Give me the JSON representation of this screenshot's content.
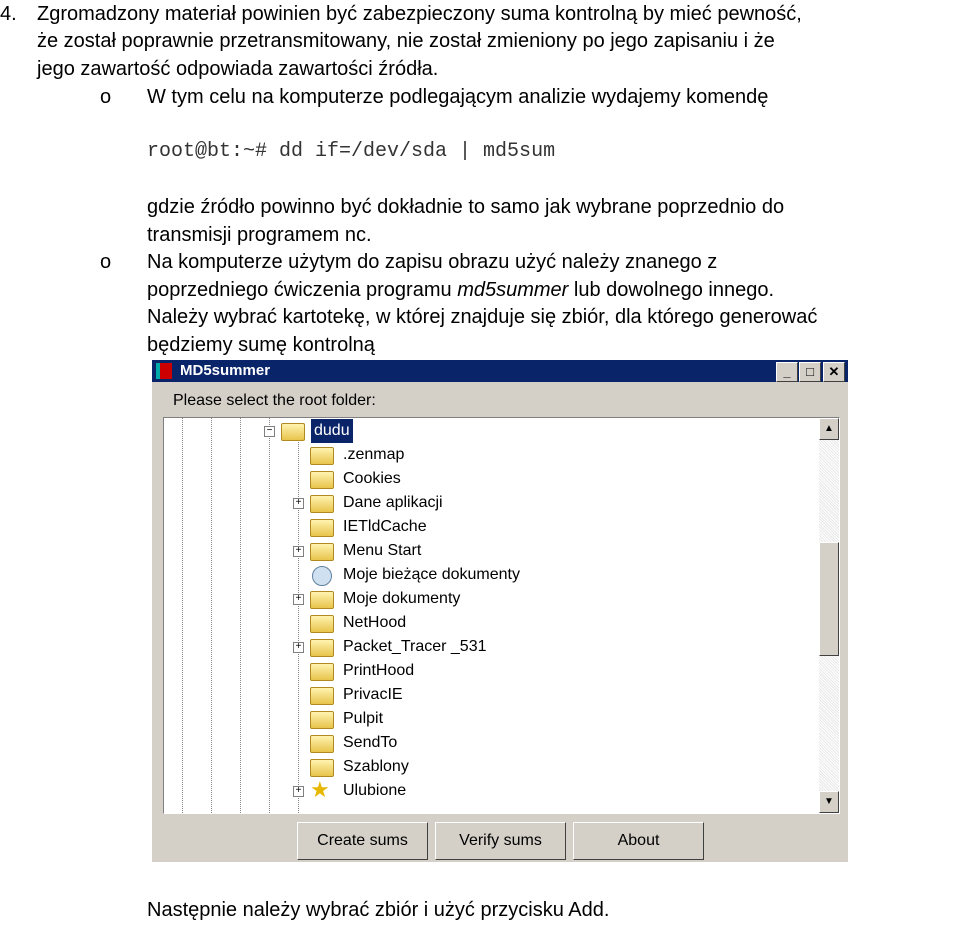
{
  "document": {
    "item_number": "4.",
    "para1_lines": [
      "Zgromadzony materiał powinien być zabezpieczony suma kontrolną by mieć pewność,",
      "że został poprawnie przetransmitowany, nie został zmieniony po jego zapisaniu i że",
      "jego zawartość odpowiada zawartości źródła."
    ],
    "bullet_glyph": "o",
    "bullet1": "W tym celu na komputerze podlegającym analizie wydajemy komendę",
    "command": "root@bt:~# dd if=/dev/sda | md5sum",
    "note_lines": [
      "gdzie źródło powinno być dokładnie to samo jak wybrane poprzednio do",
      "transmisji programem nc."
    ],
    "bullet2_line1": "Na komputerze użytym do zapisu obrazu użyć należy znanego z",
    "bullet2_line2_pre": "poprzedniego ćwiczenia programu ",
    "bullet2_line2_em": "md5summer",
    "bullet2_line2_post": " lub dowolnego innego.",
    "para2_lines": [
      "Należy wybrać kartotekę, w której znajduje się zbiór, dla którego generować",
      "będziemy sumę kontrolną"
    ],
    "final": "Następnie należy wybrać zbiór i użyć przycisku Add."
  },
  "window": {
    "title": "MD5summer",
    "prompt": "Please select the root folder:",
    "tree": [
      {
        "label": "dudu",
        "icon": "folder-open-icon",
        "expander": "minus",
        "selected": true
      },
      {
        "label": ".zenmap",
        "icon": "folder-icon"
      },
      {
        "label": "Cookies",
        "icon": "folder-icon"
      },
      {
        "label": "Dane aplikacji",
        "icon": "folder-icon",
        "expander": "plus"
      },
      {
        "label": "IETldCache",
        "icon": "folder-icon"
      },
      {
        "label": "Menu Start",
        "icon": "folder-icon",
        "expander": "plus"
      },
      {
        "label": "Moje bieżące dokumenty",
        "icon": "recent-documents-icon"
      },
      {
        "label": "Moje dokumenty",
        "icon": "folder-icon",
        "expander": "plus"
      },
      {
        "label": "NetHood",
        "icon": "folder-icon"
      },
      {
        "label": "Packet_Tracer _531",
        "icon": "folder-icon",
        "expander": "plus"
      },
      {
        "label": "PrintHood",
        "icon": "folder-icon"
      },
      {
        "label": "PrivacIE",
        "icon": "folder-icon"
      },
      {
        "label": "Pulpit",
        "icon": "folder-icon"
      },
      {
        "label": "SendTo",
        "icon": "folder-icon"
      },
      {
        "label": "Szablony",
        "icon": "folder-icon"
      },
      {
        "label": "Ulubione",
        "icon": "star-icon",
        "expander": "plus"
      }
    ],
    "buttons": [
      "Create sums",
      "Verify sums",
      "About"
    ],
    "colors": {
      "titlebar": "#0a246a",
      "face": "#d4d0c8",
      "selection": "#0a246a"
    }
  }
}
